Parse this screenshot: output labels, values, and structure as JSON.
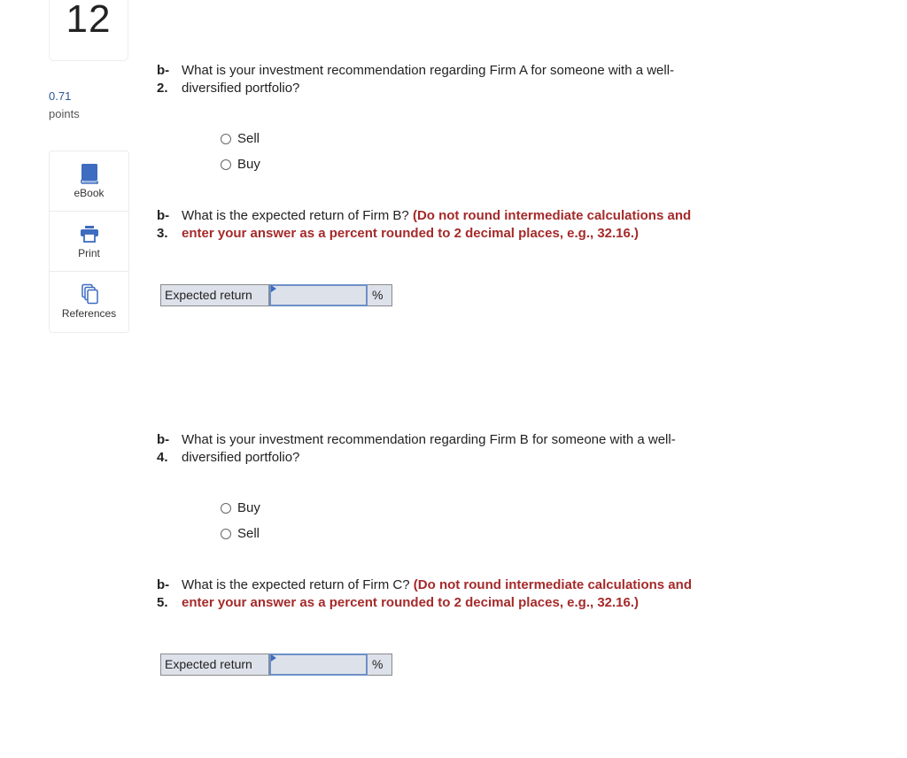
{
  "sidebar": {
    "question_number": "12",
    "points_value": "0.71",
    "points_label": "points",
    "tools": [
      {
        "label": "eBook",
        "icon": "book-icon"
      },
      {
        "label": "Print",
        "icon": "printer-icon"
      },
      {
        "label": "References",
        "icon": "documents-icon"
      }
    ]
  },
  "colors": {
    "hint_red": "#a52a2a",
    "points_blue": "#2f5597",
    "icon_blue": "#3d6cc0",
    "answer_bg": "#dde1ea"
  },
  "questions": [
    {
      "id": "b-2",
      "num_line1": "b-",
      "num_line2": "2.",
      "text_line1": "What is your investment recommendation regarding Firm A for someone with a well-",
      "text_line2": "diversified portfolio?",
      "options": [
        "Sell",
        "Buy"
      ]
    },
    {
      "id": "b-3",
      "num_line1": "b-",
      "num_line2": "3.",
      "text_line1": "What is the expected return of Firm B?",
      "hint_line1": "(Do not round intermediate calculations and",
      "hint_line2": "enter your answer as a percent rounded to 2 decimal places, e.g., 32.16.)",
      "answer_label": "Expected return",
      "answer_value": "",
      "answer_unit": "%"
    },
    {
      "id": "b-4",
      "num_line1": "b-",
      "num_line2": "4.",
      "text_line1": "What is your investment recommendation regarding Firm B for someone with a well-",
      "text_line2": "diversified portfolio?",
      "options": [
        "Buy",
        "Sell"
      ]
    },
    {
      "id": "b-5",
      "num_line1": "b-",
      "num_line2": "5.",
      "text_line1": "What is the expected return of Firm C?",
      "hint_line1": "(Do not round intermediate calculations and",
      "hint_line2": "enter your answer as a percent rounded to 2 decimal places, e.g., 32.16.)",
      "answer_label": "Expected return",
      "answer_value": "",
      "answer_unit": "%"
    }
  ]
}
